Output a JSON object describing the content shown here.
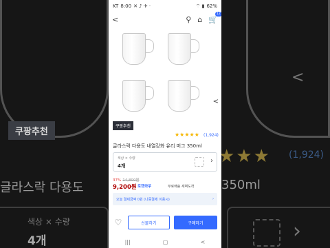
{
  "status": {
    "carrier": "KT",
    "time": "8:00",
    "battery": "62%"
  },
  "topbar": {
    "cart_count": "12"
  },
  "product": {
    "badge": "쿠팡추천",
    "rating_count": "(1,924)",
    "title": "글라스락 다용도 내열강화 유리 머그 350ml",
    "option": {
      "label": "색상 × 수량",
      "value": "4개"
    },
    "discount": "37%",
    "original_price": "14,800원",
    "price": "9,200원",
    "rocket": "로켓와우",
    "shipping": "무료배송 새벽도착",
    "banner": "오늘 결제금액 0원 (나중결제 이용시)"
  },
  "actions": {
    "gift": "선물하기",
    "buy": "구매하기"
  },
  "background": {
    "badge": "쿠팡추천",
    "rating": "(1,924)",
    "title_left": "글라스락 다용도",
    "title_right": "350ml",
    "option_label": "색상 × 수량",
    "option_value": "4개"
  },
  "colors": {
    "accent": "#346aff",
    "price": "#ae0000",
    "star": "#f5b600"
  }
}
